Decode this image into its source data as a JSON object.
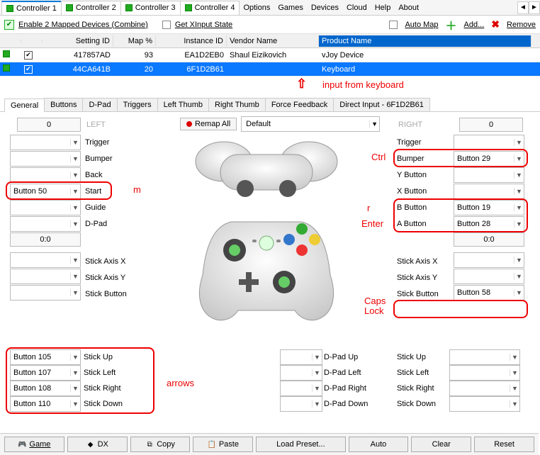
{
  "top_tabs": {
    "controller1": "Controller 1",
    "controller2": "Controller 2",
    "controller3": "Controller 3",
    "controller4": "Controller 4",
    "options": "Options",
    "games": "Games",
    "devices": "Devices",
    "cloud": "Cloud",
    "help": "Help",
    "about": "About"
  },
  "toolbar": {
    "enable_label": "Enable 2 Mapped Devices (Combine)",
    "get_xinput": "Get XInput State",
    "auto_map": "Auto Map",
    "add": "Add...",
    "remove": "Remove"
  },
  "grid": {
    "headers": {
      "setting_id": "Setting ID",
      "map_pct": "Map %",
      "instance_id": "Instance ID",
      "vendor_name": "Vendor Name",
      "product_name": "Product Name"
    },
    "rows": [
      {
        "setting_id": "417857AD",
        "map_pct": "93",
        "instance_id": "EA1D2EB0",
        "vendor": "Shaul Eizikovich",
        "product": "vJoy Device"
      },
      {
        "setting_id": "44CA641B",
        "map_pct": "20",
        "instance_id": "6F1D2B61",
        "vendor": "",
        "product": "Keyboard"
      }
    ]
  },
  "annot": {
    "arrow": "⇧",
    "text": "input from keyboard"
  },
  "sub_tabs": {
    "general": "General",
    "buttons": "Buttons",
    "dpad": "D-Pad",
    "triggers": "Triggers",
    "left_thumb": "Left Thumb",
    "right_thumb": "Right Thumb",
    "force_feedback": "Force Feedback",
    "direct_input": "Direct Input - 6F1D2B61"
  },
  "center": {
    "remap_all": "Remap All",
    "preset": "Default"
  },
  "left": {
    "header": "LEFT",
    "num": "0",
    "zero": "0:0",
    "trigger": "Trigger",
    "bumper": "Bumper",
    "back": "Back",
    "start": "Start",
    "guide": "Guide",
    "dpad": "D-Pad",
    "stick_axis_x": "Stick Axis X",
    "stick_axis_y": "Stick Axis Y",
    "stick_button": "Stick Button",
    "stick_up": "Stick Up",
    "stick_left": "Stick Left",
    "stick_right": "Stick Right",
    "stick_down": "Stick Down",
    "vals": {
      "trigger": "",
      "bumper": "",
      "back": "",
      "start": "Button 50",
      "guide": "",
      "dpad": "",
      "sax": "",
      "say": "",
      "sbtn": "",
      "su": "Button 105",
      "sl": "Button 107",
      "sr": "Button 108",
      "sd": "Button 110"
    }
  },
  "right": {
    "header": "RIGHT",
    "num": "0",
    "zero": "0:0",
    "trigger": "Trigger",
    "bumper": "Bumper",
    "y": "Y Button",
    "x": "X Button",
    "b": "B Button",
    "a": "A Button",
    "stick_axis_x": "Stick Axis X",
    "stick_axis_y": "Stick Axis Y",
    "stick_button": "Stick Button",
    "stick_up": "Stick Up",
    "stick_left": "Stick Left",
    "stick_right": "Stick Right",
    "stick_down": "Stick Down",
    "vals": {
      "trigger": "",
      "bumper": "Button 29",
      "y": "",
      "x": "",
      "b": "Button 19",
      "a": "Button 28",
      "sax": "",
      "say": "",
      "sbtn": "Button 58",
      "su": "",
      "sl": "",
      "sr": "",
      "sd": ""
    }
  },
  "dpad": {
    "up": "D-Pad Up",
    "left": "D-Pad Left",
    "right": "D-Pad Right",
    "down": "D-Pad Down"
  },
  "red_annot": {
    "m": "m",
    "ctrl": "Ctrl",
    "r": "r",
    "enter": "Enter",
    "caps": "Caps Lock",
    "arrows": "arrows"
  },
  "bottom": {
    "game": "Game",
    "dx": "DX",
    "copy": "Copy",
    "paste": "Paste",
    "load_preset": "Load Preset...",
    "auto": "Auto",
    "clear": "Clear",
    "reset": "Reset"
  }
}
